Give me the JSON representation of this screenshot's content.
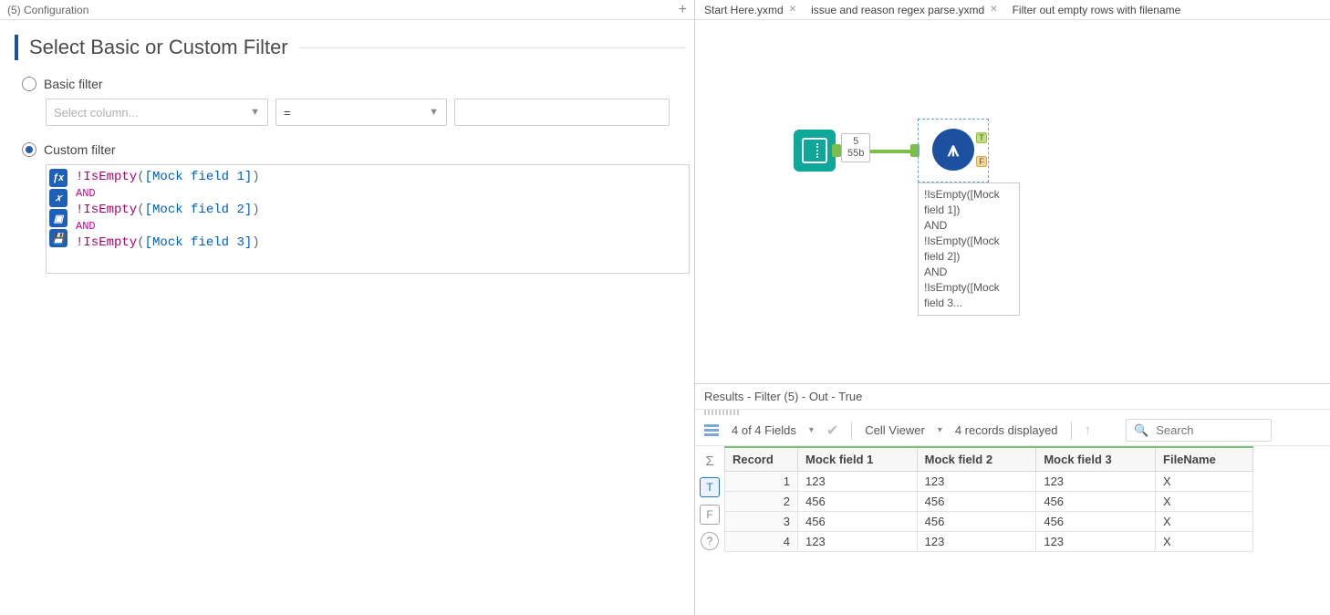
{
  "config": {
    "header_label": "(5)   Configuration",
    "heading": "Select Basic or Custom Filter",
    "basic_label": "Basic filter",
    "custom_label": "Custom filter",
    "column_placeholder": "Select column...",
    "operator_value": "=",
    "expression": {
      "line1_fn": "!IsEmpty",
      "line1_field": "[Mock field 1]",
      "and1": "AND",
      "line2_fn": "!IsEmpty",
      "line2_field": "[Mock field 2]",
      "and2": "AND",
      "line3_fn": "!IsEmpty",
      "line3_field": "[Mock field 3]"
    },
    "tool_icons": [
      "fx",
      "x",
      "□",
      "💾"
    ]
  },
  "tabs": {
    "tab1": "Start Here.yxmd",
    "tab2": "issue and reason regex parse.yxmd",
    "tab3": "Filter out empty rows with filename"
  },
  "canvas": {
    "badge_line1": "5",
    "badge_line2": "55b",
    "anchor_t": "T",
    "anchor_f": "F",
    "annotation": "!IsEmpty([Mock field 1])\nAND\n!IsEmpty([Mock field 2])\nAND\n!IsEmpty([Mock field 3..."
  },
  "results": {
    "title": "Results - Filter (5) - Out - True",
    "fields_summary": "4 of 4 Fields",
    "cell_viewer": "Cell Viewer",
    "records_summary": "4 records displayed",
    "search_placeholder": "Search",
    "headers": {
      "record": "Record",
      "c1": "Mock field 1",
      "c2": "Mock field 2",
      "c3": "Mock field 3",
      "c4": "FileName"
    },
    "rows": [
      {
        "n": "1",
        "c1": "123",
        "c2": "123",
        "c3": "123",
        "c4": "X"
      },
      {
        "n": "2",
        "c1": "456",
        "c2": "456",
        "c3": "456",
        "c4": "X"
      },
      {
        "n": "3",
        "c1": "456",
        "c2": "456",
        "c3": "456",
        "c4": "X"
      },
      {
        "n": "4",
        "c1": "123",
        "c2": "123",
        "c3": "123",
        "c4": "X"
      }
    ],
    "true_btn": "T",
    "false_btn": "F"
  }
}
